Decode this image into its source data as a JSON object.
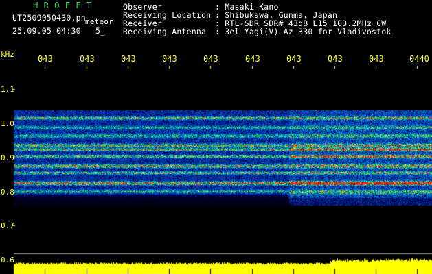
{
  "header": {
    "program_title": "HROFFT",
    "filename": "UT2509050430.pn",
    "event_type": "meteor",
    "date_time": "25.09.05 04:30",
    "count_text": "5_",
    "fields": [
      {
        "label": "Observer",
        "value": ": Masaki Kano"
      },
      {
        "label": "Receiving Location",
        "value": ": Shibukawa, Gunma, Japan"
      },
      {
        "label": "Receiver",
        "value": ": RTL-SDR SDR# 43dB L15 103.2MHz CW"
      },
      {
        "label": "Receiving Antenna",
        "value": ": 3el Yagi(V) Az 330 for Vladivostok"
      }
    ]
  },
  "axes": {
    "y_unit": "kHz",
    "y_ticks": [
      "1.1",
      "1.0",
      "0.9",
      "0.8",
      "0.7",
      "0.6"
    ],
    "x_ticks": [
      "043",
      "043",
      "043",
      "043",
      "043",
      "043",
      "043",
      "043",
      "043",
      "0440"
    ]
  },
  "colors": {
    "background": "#000000",
    "label_yellow": "#ffff33",
    "title_green": "#33d15a",
    "baseline_yellow": "#ffff00",
    "spectrogram_base": "#06188a"
  }
}
